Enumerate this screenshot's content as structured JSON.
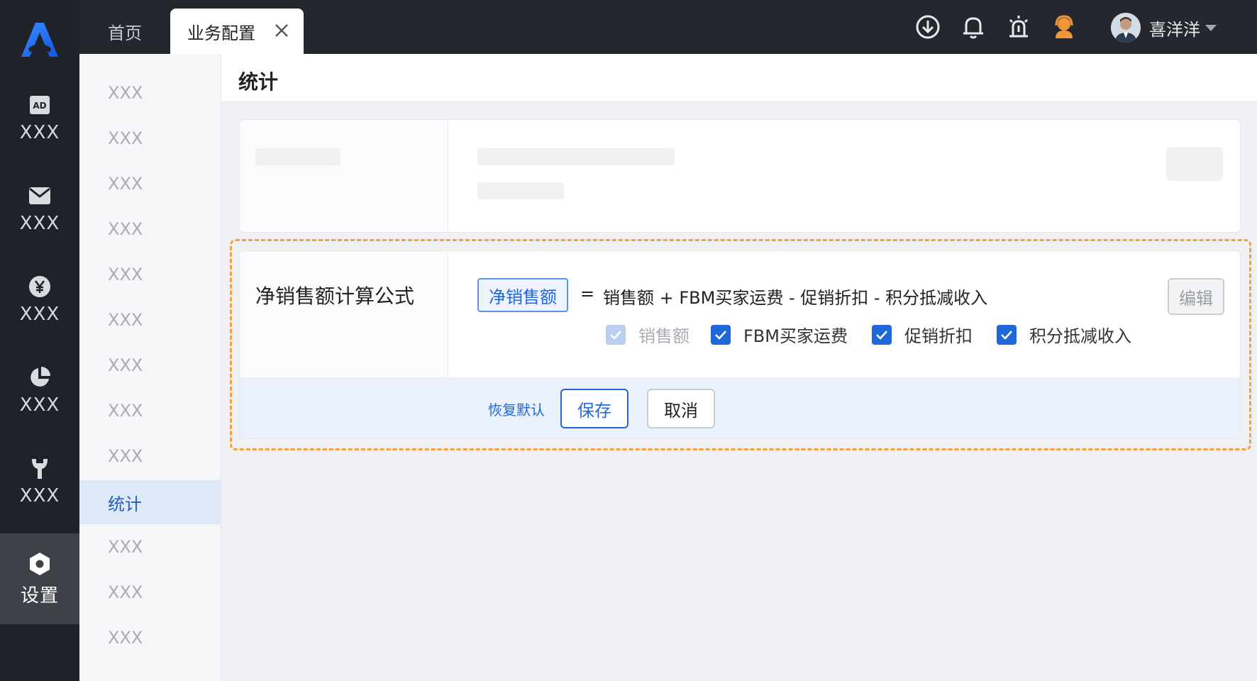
{
  "rail": {
    "items": [
      {
        "icon": "ad-icon",
        "label": "XXX"
      },
      {
        "icon": "mail-icon",
        "label": "XXX"
      },
      {
        "icon": "yen-icon",
        "label": "XXX"
      },
      {
        "icon": "pie-chart-icon",
        "label": "XXX"
      },
      {
        "icon": "wrench-icon",
        "label": "XXX"
      },
      {
        "icon": "gear-icon",
        "label": "设置"
      }
    ]
  },
  "tabs": {
    "home": "首页",
    "active": "业务配置"
  },
  "topbar": {
    "icons": [
      "download-icon",
      "bell-icon",
      "alarm-icon",
      "support-agent-icon"
    ],
    "username": "喜洋洋"
  },
  "subside": {
    "items": [
      "XXX",
      "XXX",
      "XXX",
      "XXX",
      "XXX",
      "XXX",
      "XXX",
      "XXX",
      "XXX",
      "统计",
      "XXX",
      "XXX",
      "XXX"
    ]
  },
  "page": {
    "title": "统计"
  },
  "formula": {
    "label": "净销售额计算公式",
    "target": "净销售额",
    "equals": "=",
    "expression": "销售额 + FBM买家运费 - 促销折扣 - 积分抵减收入",
    "edit_label": "编辑",
    "options": [
      {
        "label": "销售额",
        "checked": true,
        "disabled": true
      },
      {
        "label": "FBM买家运费",
        "checked": true,
        "disabled": false
      },
      {
        "label": "促销折扣",
        "checked": true,
        "disabled": false
      },
      {
        "label": "积分抵减收入",
        "checked": true,
        "disabled": false
      }
    ],
    "restore_label": "恢复默认",
    "save_label": "保存",
    "cancel_label": "取消"
  },
  "colors": {
    "accent": "#1f68d9",
    "highlight_border": "#f5a140",
    "rail_bg": "#1f2229"
  }
}
